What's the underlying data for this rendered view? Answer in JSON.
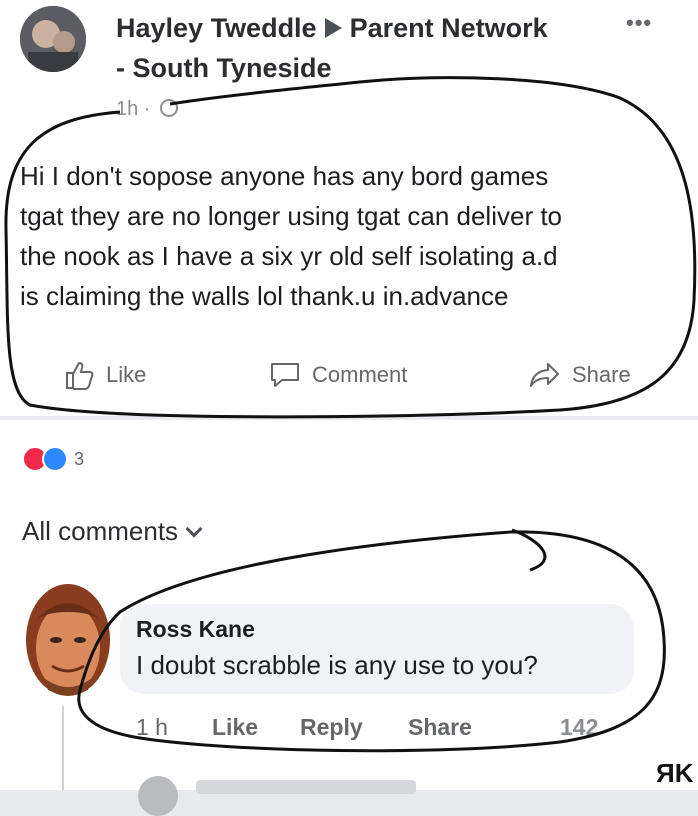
{
  "post": {
    "author": "Hayley Tweddle",
    "group_line1": "Parent Network",
    "group_line2": "- South Tyneside",
    "time": "1h",
    "text_lines": [
      "Hi I don't sopose anyone has any bord games",
      "tgat they are no longer using tgat can deliver to",
      "the nook as I have a six yr old self isolating a.d",
      "is claiming the walls lol  thank.u in.advance"
    ],
    "actions": {
      "like": "Like",
      "comment": "Comment",
      "share": "Share"
    },
    "reaction_count": "3"
  },
  "comments": {
    "header": "All comments",
    "items": [
      {
        "author": "Ross Kane",
        "text": "I doubt scrabble is any use to you?",
        "time": "1 h",
        "like": "Like",
        "reply": "Reply",
        "share": "Share",
        "reactions": "142"
      }
    ]
  },
  "watermark": "ЯK",
  "colors": {
    "background": "#e9eaed",
    "card": "#ffffff",
    "text": "#1c1e21",
    "secondary": "#65676b",
    "heart": "#f0284a",
    "like_blue": "#2d88ff"
  },
  "icons": [
    "more-icon",
    "arrow-icon",
    "globe-icon",
    "like-icon",
    "comment-icon",
    "share-icon",
    "chevron-down-icon"
  ]
}
